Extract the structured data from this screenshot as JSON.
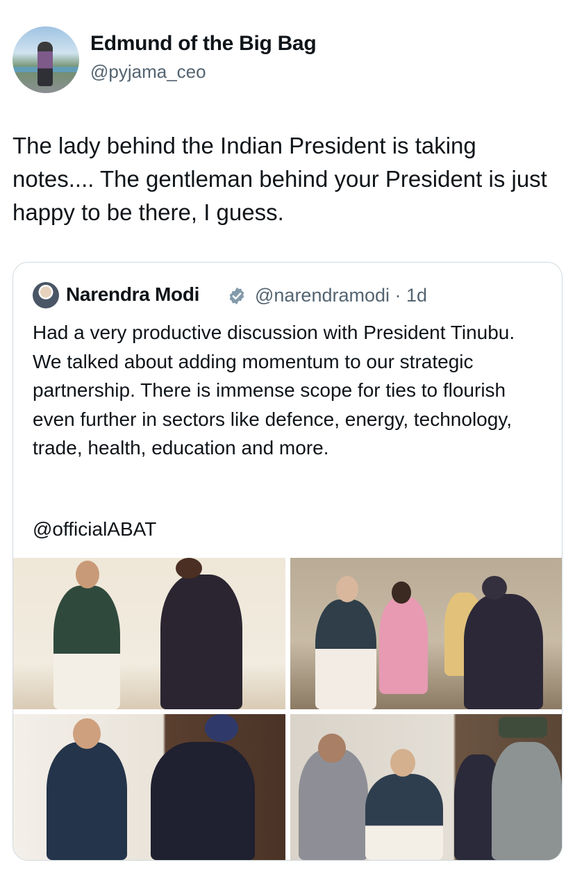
{
  "author": {
    "name": "Edmund of the Big Bag",
    "handle": "@pyjama_ceo",
    "avatar_icon": "profile-photo"
  },
  "tweet": {
    "text": "The lady behind the Indian President is taking notes.... The gentleman behind your President is just happy to be there, I guess."
  },
  "quoted": {
    "name": "Narendra Modi",
    "verified_icon": "verified-badge-icon",
    "handle_time": "@narendramodi · 1d",
    "text": "Had a very productive discussion with President Tinubu. We talked about adding momentum to our strategic partnership. There is immense scope for ties to flourish even further in sectors like defence, energy, technology, trade, health, education and more.",
    "mention": "@officialABAT",
    "photos": [
      {
        "icon": "photo-handshake"
      },
      {
        "icon": "photo-meeting"
      },
      {
        "icon": "photo-handshake-flags"
      },
      {
        "icon": "photo-document-exchange"
      }
    ]
  },
  "colors": {
    "text": "#0f1419",
    "secondary": "#536471",
    "border": "#cfd9de",
    "verified_badge": "#829aab"
  }
}
